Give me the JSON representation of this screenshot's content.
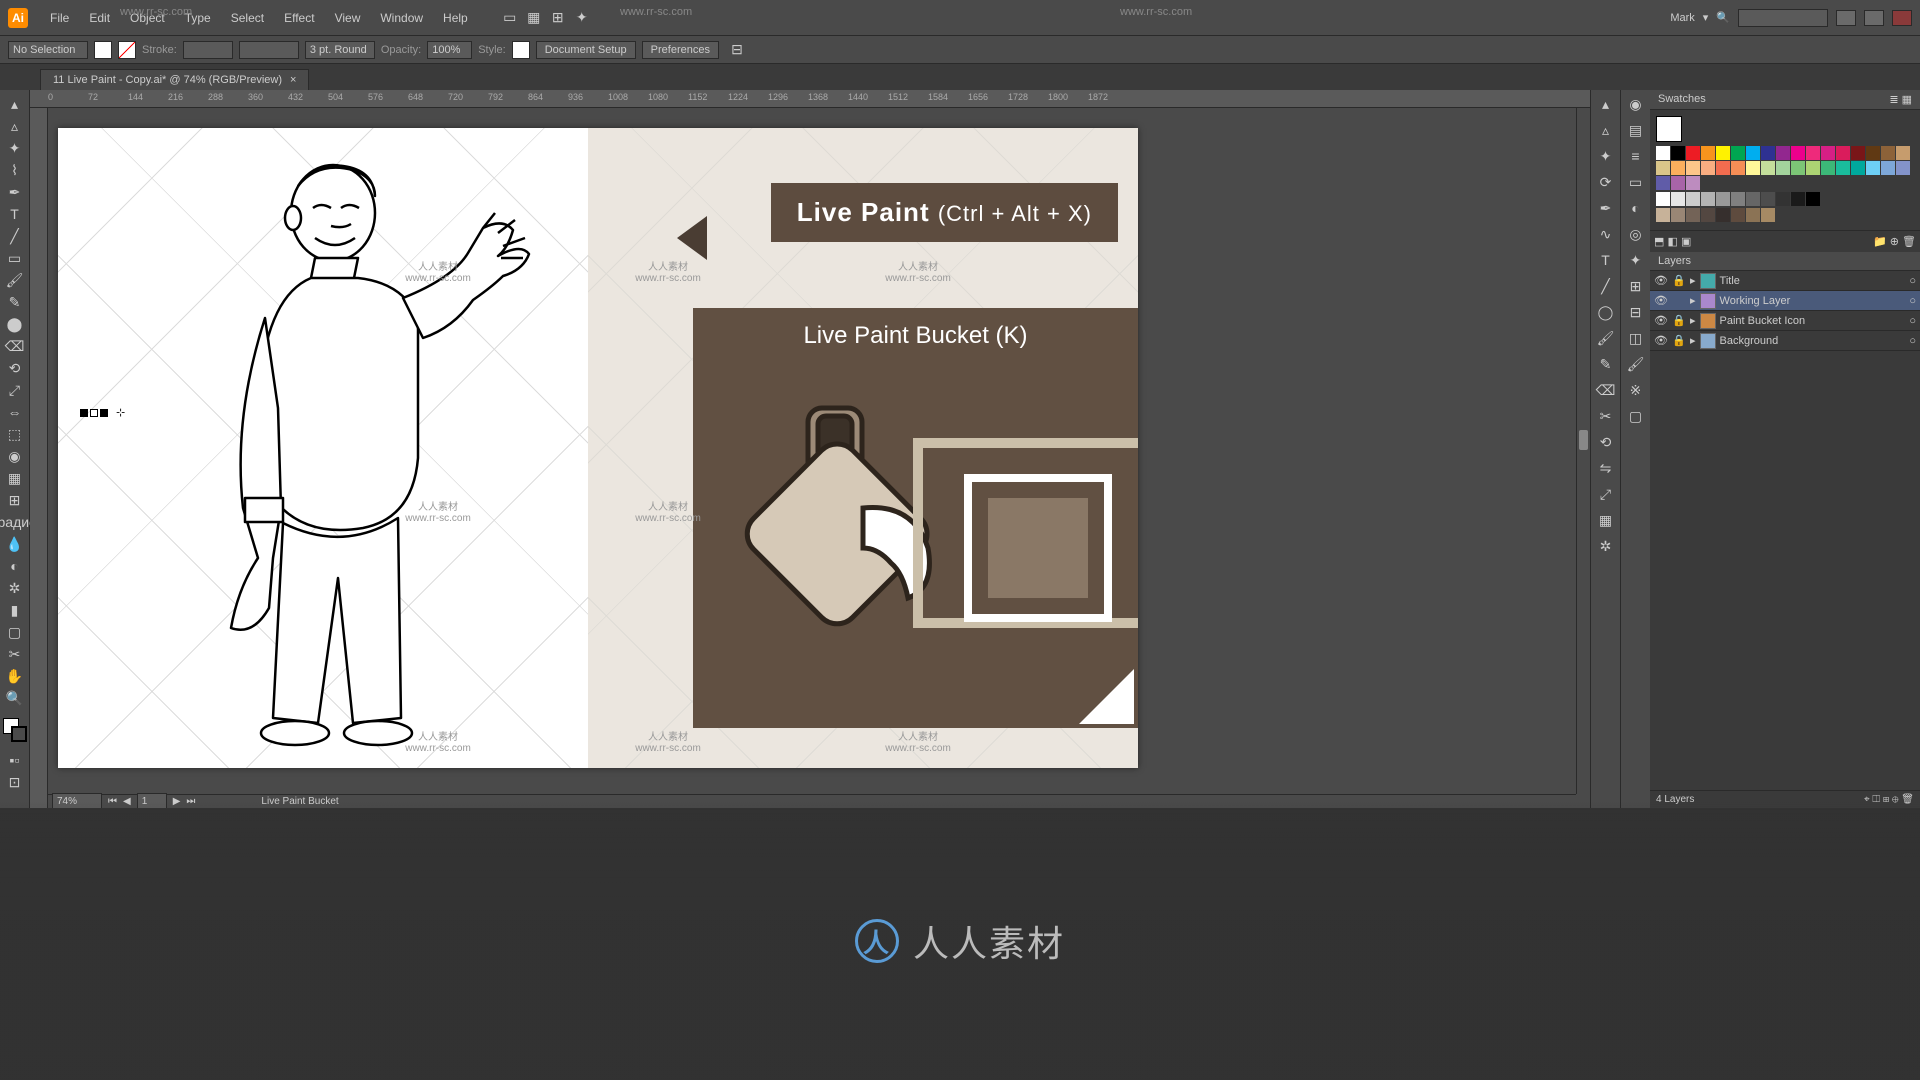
{
  "menubar": {
    "items": [
      "File",
      "Edit",
      "Object",
      "Type",
      "Select",
      "Effect",
      "View",
      "Window",
      "Help"
    ],
    "user": "Mark",
    "search_placeholder": ""
  },
  "optionsbar": {
    "selection": "No Selection",
    "stroke_label": "Stroke:",
    "stroke_value": "",
    "stroke_weight": "3 pt. Round",
    "opacity_label": "Opacity:",
    "opacity_value": "100%",
    "style_label": "Style:",
    "doc_setup": "Document Setup",
    "prefs": "Preferences"
  },
  "document": {
    "tab_title": "11 Live Paint - Copy.ai* @ 74% (RGB/Preview)"
  },
  "ruler_ticks": [
    "0",
    "72",
    "144",
    "216",
    "288",
    "360",
    "432",
    "504",
    "576",
    "648",
    "720",
    "792",
    "864",
    "936",
    "1008",
    "1080",
    "1152",
    "1224",
    "1296",
    "1368",
    "1440",
    "1512",
    "1584",
    "1656",
    "1728",
    "1800",
    "1872"
  ],
  "canvas": {
    "banner_main": "Live Paint",
    "banner_shortcut": "(Ctrl + Alt + X)",
    "panel_title": "Live Paint Bucket (K)",
    "watermark_cn": "人人素材",
    "watermark_url": "www.rr-sc.com"
  },
  "statusbar": {
    "zoom": "74%",
    "artboard_index": "1",
    "tool_name": "Live Paint Bucket"
  },
  "swatches": {
    "title": "Swatches",
    "colors_main": [
      "#ffffff",
      "#000000",
      "#ed1c24",
      "#f7941d",
      "#fff200",
      "#00a651",
      "#00aeef",
      "#2e3192",
      "#92278f",
      "#ec008c",
      "#ee2a7b",
      "#d71f85",
      "#da1c5c",
      "#791618",
      "#603913",
      "#8c6239",
      "#c69c6d",
      "#d9c589",
      "#fbaf5d",
      "#fdc689",
      "#f9ad81",
      "#f26c4f",
      "#f68e56",
      "#fff799",
      "#c4df9b",
      "#a3d39c",
      "#7cc576",
      "#acd373",
      "#3cb878",
      "#1abc9c",
      "#00a99d",
      "#6dcff6",
      "#7da7d9",
      "#8393ca",
      "#605ca8",
      "#a864a8",
      "#bd8cbf"
    ],
    "colors_grays": [
      "#ffffff",
      "#e6e6e6",
      "#cccccc",
      "#b3b3b3",
      "#999999",
      "#808080",
      "#666666",
      "#4d4d4d",
      "#333333",
      "#1a1a1a",
      "#000000"
    ],
    "colors_extra": [
      "#c7b299",
      "#998675",
      "#736357",
      "#534741",
      "#362f2d",
      "#5e4b3e",
      "#8b7355",
      "#a68a64"
    ]
  },
  "layers": {
    "title": "Layers",
    "items": [
      {
        "name": "Title",
        "color": "#4aa",
        "selected": false,
        "locked": true
      },
      {
        "name": "Working Layer",
        "color": "#a8c",
        "selected": true,
        "locked": false
      },
      {
        "name": "Paint Bucket Icon",
        "color": "#c84",
        "selected": false,
        "locked": true
      },
      {
        "name": "Background",
        "color": "#8ac",
        "selected": false,
        "locked": true
      }
    ],
    "footer": "4 Layers"
  },
  "overlay": {
    "brand": "人人素材",
    "url_top": "www.rr-sc.com"
  }
}
